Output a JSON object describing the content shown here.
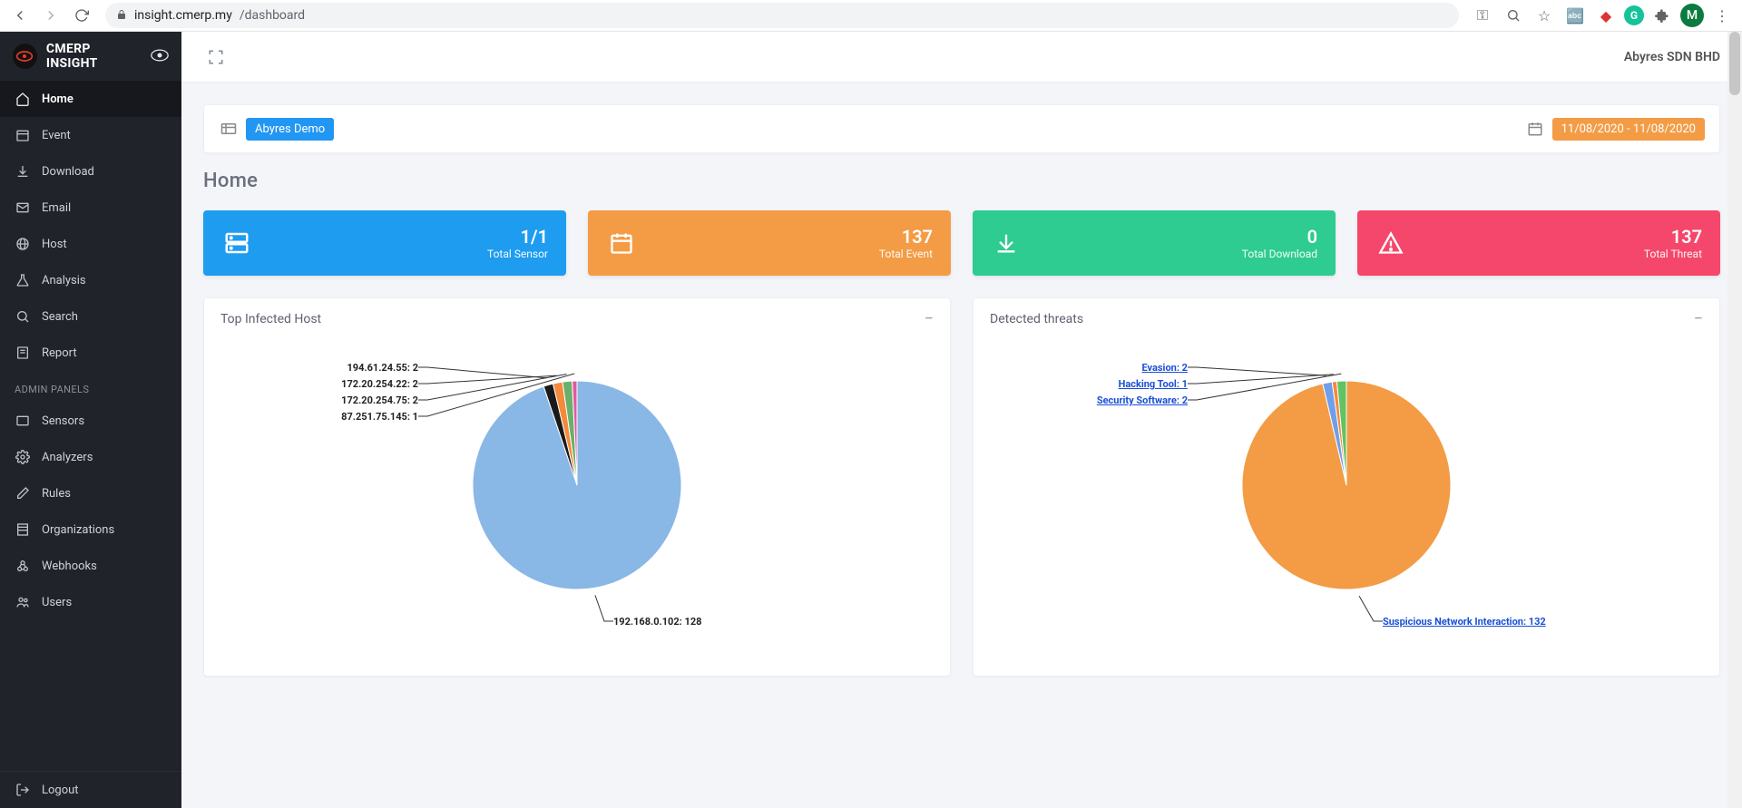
{
  "browser": {
    "url_host": "insight.cmerp.my",
    "url_path": "/dashboard",
    "avatar_letter": "M"
  },
  "brand": "CMERP INSIGHT",
  "sidebar": {
    "items": [
      {
        "label": "Home",
        "icon": "home",
        "active": true
      },
      {
        "label": "Event",
        "icon": "calendar"
      },
      {
        "label": "Download",
        "icon": "download"
      },
      {
        "label": "Email",
        "icon": "mail"
      },
      {
        "label": "Host",
        "icon": "globe"
      },
      {
        "label": "Analysis",
        "icon": "flask"
      },
      {
        "label": "Search",
        "icon": "search"
      },
      {
        "label": "Report",
        "icon": "report"
      }
    ],
    "admin_label": "ADMIN PANELS",
    "admin_items": [
      {
        "label": "Sensors",
        "icon": "sensors"
      },
      {
        "label": "Analyzers",
        "icon": "gear"
      },
      {
        "label": "Rules",
        "icon": "edit"
      },
      {
        "label": "Organizations",
        "icon": "org"
      },
      {
        "label": "Webhooks",
        "icon": "webhook"
      },
      {
        "label": "Users",
        "icon": "users"
      }
    ],
    "logout": "Logout"
  },
  "topbar": {
    "company": "Abyres SDN BHD"
  },
  "filter": {
    "org": "Abyres Demo",
    "daterange": "11/08/2020 - 11/08/2020"
  },
  "page_title": "Home",
  "stats": [
    {
      "value": "1/1",
      "label": "Total Sensor",
      "color": "c-blue",
      "icon": "server"
    },
    {
      "value": "137",
      "label": "Total Event",
      "color": "c-orange",
      "icon": "calendar-big"
    },
    {
      "value": "0",
      "label": "Total Download",
      "color": "c-green",
      "icon": "download-big"
    },
    {
      "value": "137",
      "label": "Total Threat",
      "color": "c-pink",
      "icon": "alert"
    }
  ],
  "panels": {
    "left": {
      "title": "Top Infected Host"
    },
    "right": {
      "title": "Detected threats"
    }
  },
  "chart_data": [
    {
      "id": "top_infected_host",
      "type": "pie",
      "title": "Top Infected Host",
      "series": [
        {
          "name": "192.168.0.102",
          "value": 128,
          "color": "#89b7e6"
        },
        {
          "name": "194.61.24.55",
          "value": 2,
          "color": "#1a1a1a"
        },
        {
          "name": "172.20.254.22",
          "value": 2,
          "color": "#f58a3c"
        },
        {
          "name": "172.20.254.75",
          "value": 2,
          "color": "#6ab06a"
        },
        {
          "name": "87.251.75.145",
          "value": 1,
          "color": "#e05aa0"
        }
      ],
      "label_style": "plain"
    },
    {
      "id": "detected_threats",
      "type": "pie",
      "title": "Detected threats",
      "series": [
        {
          "name": "Suspicious Network Interaction",
          "value": 132,
          "color": "#f39c45"
        },
        {
          "name": "Evasion",
          "value": 2,
          "color": "#6f9fe8"
        },
        {
          "name": "Hacking Tool",
          "value": 1,
          "color": "#f58a3c"
        },
        {
          "name": "Security Software",
          "value": 2,
          "color": "#63c263"
        }
      ],
      "label_style": "link"
    }
  ]
}
